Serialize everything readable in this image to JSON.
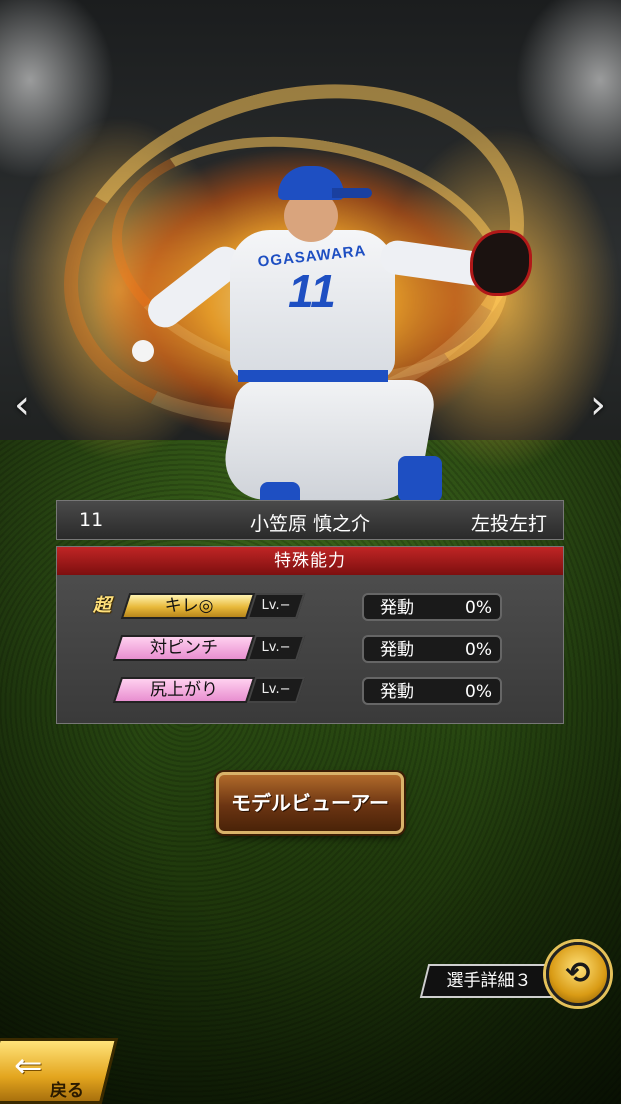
{
  "player": {
    "number": "11",
    "name": "小笠原 慎之介",
    "bats_throws": "左投左打",
    "jersey_name": "OGASAWARA",
    "jersey_number": "11"
  },
  "nav": {
    "prev_icon": "chevron-left-icon",
    "next_icon": "chevron-right-icon",
    "prev_glyph": "‹",
    "next_glyph": "›"
  },
  "abilities": {
    "header": "特殊能力",
    "items": [
      {
        "super_mark": "超",
        "name": "キレ◎",
        "level": "Lv.−",
        "rate_label": "発動",
        "rate_value": "0%",
        "color": "gold"
      },
      {
        "super_mark": "",
        "name": "対ピンチ",
        "level": "Lv.−",
        "rate_label": "発動",
        "rate_value": "0%",
        "color": "pink"
      },
      {
        "super_mark": "",
        "name": "尻上がり",
        "level": "Lv.−",
        "rate_label": "発動",
        "rate_value": "0%",
        "color": "pink"
      }
    ]
  },
  "buttons": {
    "model_viewer": "モデルビューアー",
    "detail": "選手詳細３",
    "swap_glyph": "⟲",
    "back": "戻る",
    "back_glyph": "⇐"
  },
  "colors": {
    "gold_tag": "#e8b93a",
    "pink_tag": "#e88fd0",
    "panel_header": "#c02525",
    "team_blue": "#1e4fc2"
  }
}
